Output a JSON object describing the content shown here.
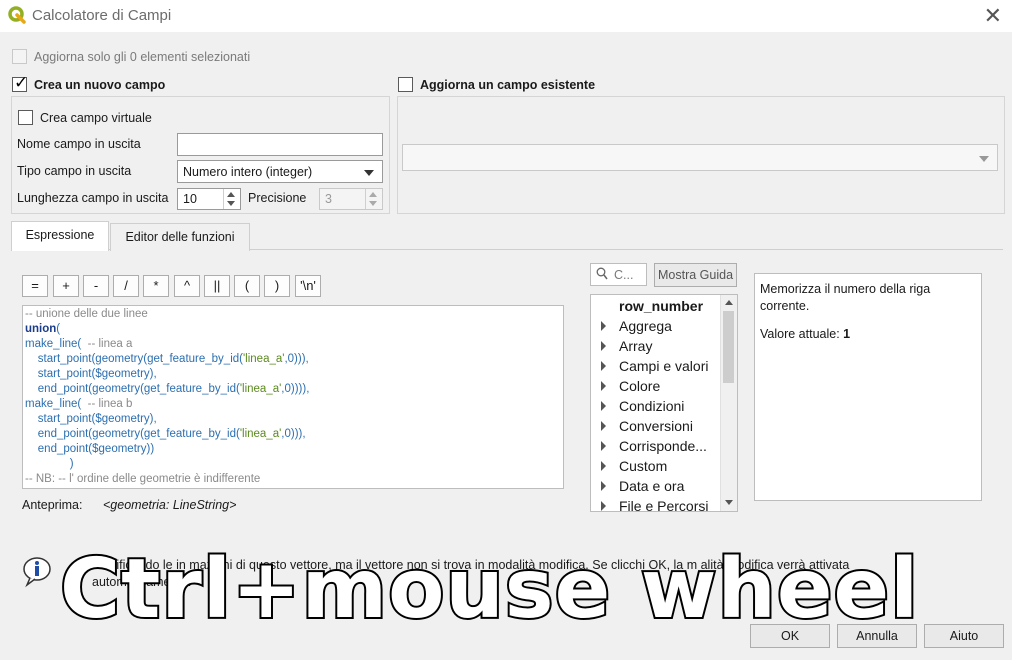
{
  "window": {
    "title": "Calcolatore di Campi",
    "close_glyph": "✕"
  },
  "top": {
    "update_selected_label": "Aggiorna solo gli 0 elementi selezionati",
    "create_new_field_label": "Crea un nuovo campo",
    "update_existing_field_label": "Aggiorna un campo esistente"
  },
  "new_field": {
    "virtual_label": "Crea campo virtuale",
    "name_label": "Nome campo in uscita",
    "name_value": "",
    "type_label": "Tipo campo in uscita",
    "type_value": "Numero intero (integer)",
    "length_label": "Lunghezza campo in uscita",
    "length_value": "10",
    "precision_label": "Precisione",
    "precision_value": "3"
  },
  "tabs": [
    {
      "label": "Espressione"
    },
    {
      "label": "Editor delle funzioni"
    }
  ],
  "operators": [
    "=",
    "+",
    "-",
    "/",
    "*",
    "^",
    "||",
    "(",
    ")",
    "'\\n'"
  ],
  "search": {
    "placeholder": "C..."
  },
  "show_help_label": "Mostra Guida",
  "function_tree": {
    "selected": "row_number",
    "groups": [
      "Aggrega",
      "Array",
      "Campi e valori",
      "Colore",
      "Condizioni",
      "Conversioni",
      "Corrisponde...",
      "Custom",
      "Data e ora",
      "File e Percorsi"
    ]
  },
  "help": {
    "description": "Memorizza il numero della riga corrente.",
    "current_value_label": "Valore attuale:",
    "current_value": "1"
  },
  "preview": {
    "label": "Anteprima:",
    "value": "<geometria: LineString>"
  },
  "info": {
    "message_line1": "modificando le in   mazioni di questo vettore, ma il vettore non si trova in modalità modifica. Se clicchi OK, la m   alità modifica verrà attivata",
    "message_line2": "automaticamente."
  },
  "buttons": {
    "ok": "OK",
    "cancel": "Annulla",
    "help": "Aiuto"
  },
  "overlay_caption": "Ctrl+mouse wheel",
  "colors": {
    "keyword": "#1b3d8a",
    "function": "#2c6fb0",
    "string": "#5b8a1e",
    "comment": "#8a8a8a"
  }
}
